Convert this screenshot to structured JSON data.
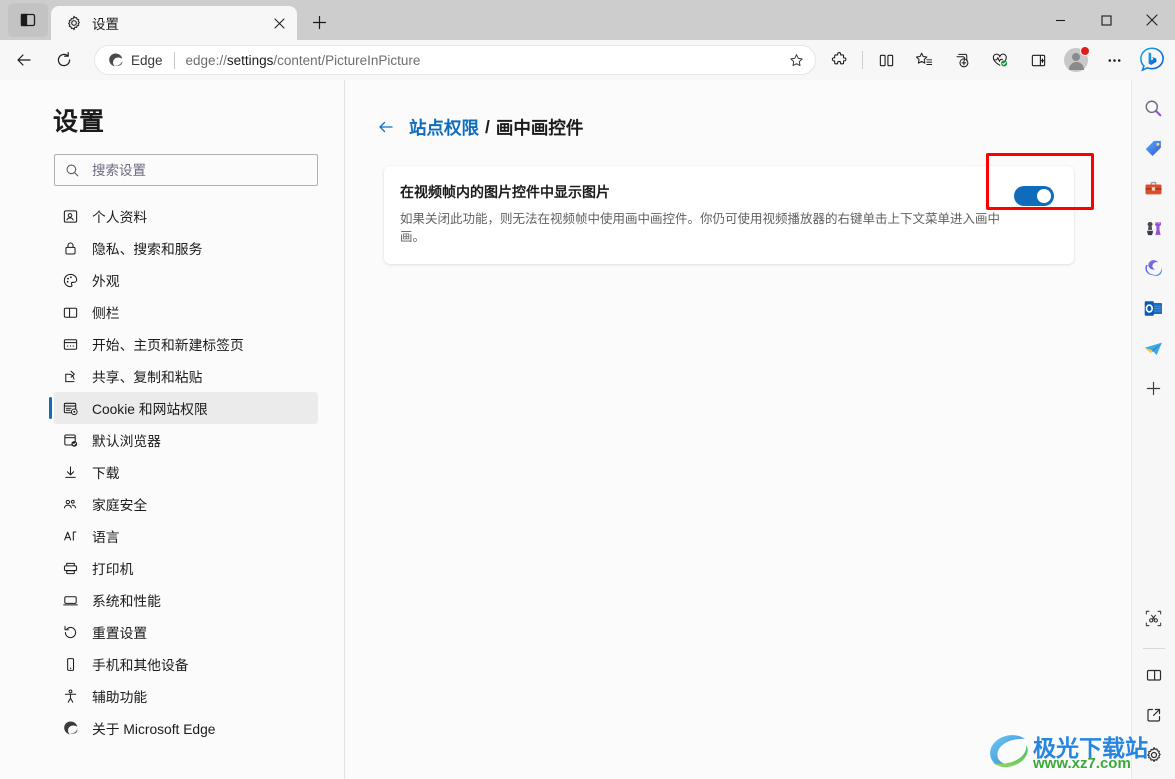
{
  "window": {
    "tab_actions_label": "tab-actions",
    "minimize_label": "–",
    "maximize_label": "□",
    "close_label": "✕"
  },
  "tab": {
    "title": "设置",
    "close_label": "✕",
    "new_tab_label": "+",
    "favicon": "gear-icon"
  },
  "toolbar": {
    "back_label": "←",
    "refresh_label": "⟳",
    "edge_badge_text": "Edge",
    "url_prefix": "edge://",
    "url_bold": "settings",
    "url_suffix": "/content/PictureInPicture",
    "url_full": "edge://settings/content/PictureInPicture",
    "icons": [
      {
        "name": "extensions-icon"
      },
      {
        "name": "split-screen-icon"
      },
      {
        "name": "favorites-icon"
      },
      {
        "name": "collections-icon"
      },
      {
        "name": "browser-essentials-icon"
      },
      {
        "name": "sidebar-toggle-icon"
      }
    ],
    "profile_name": "profile-avatar",
    "more_label": "⋯",
    "copilot_label": "b"
  },
  "sidebar": {
    "title": "设置",
    "search": {
      "placeholder": "搜索设置",
      "value": ""
    },
    "items": [
      {
        "label": "个人资料",
        "icon": "profile-icon",
        "selected": false
      },
      {
        "label": "隐私、搜索和服务",
        "icon": "lock-icon",
        "selected": false
      },
      {
        "label": "外观",
        "icon": "palette-icon",
        "selected": false
      },
      {
        "label": "侧栏",
        "icon": "sidebar-icon",
        "selected": false
      },
      {
        "label": "开始、主页和新建标签页",
        "icon": "home-page-icon",
        "selected": false
      },
      {
        "label": "共享、复制和粘贴",
        "icon": "share-icon",
        "selected": false
      },
      {
        "label": "Cookie 和网站权限",
        "icon": "cookie-permissions-icon",
        "selected": true
      },
      {
        "label": "默认浏览器",
        "icon": "default-browser-icon",
        "selected": false
      },
      {
        "label": "下载",
        "icon": "download-icon",
        "selected": false
      },
      {
        "label": "家庭安全",
        "icon": "family-safety-icon",
        "selected": false
      },
      {
        "label": "语言",
        "icon": "language-icon",
        "selected": false
      },
      {
        "label": "打印机",
        "icon": "printer-icon",
        "selected": false
      },
      {
        "label": "系统和性能",
        "icon": "system-icon",
        "selected": false
      },
      {
        "label": "重置设置",
        "icon": "reset-icon",
        "selected": false
      },
      {
        "label": "手机和其他设备",
        "icon": "phone-icon",
        "selected": false
      },
      {
        "label": "辅助功能",
        "icon": "accessibility-icon",
        "selected": false
      },
      {
        "label": "关于 Microsoft Edge",
        "icon": "edge-logo-icon",
        "selected": false
      }
    ]
  },
  "main": {
    "breadcrumb": {
      "back_label": "←",
      "parent": "站点权限",
      "separator": "/",
      "current": "画中画控件"
    },
    "setting": {
      "title": "在视频帧内的图片控件中显示图片",
      "description": "如果关闭此功能，则无法在视频帧中使用画中画控件。你仍可使用视频播放器的右键单击上下文菜单进入画中画。",
      "toggle_state": "on",
      "toggle_color": "#0f6cbd"
    },
    "annotation": {
      "color": "#fd0000"
    }
  },
  "edge_sidebar": {
    "items": [
      {
        "name": "search-icon"
      },
      {
        "name": "shopping-tag-icon"
      },
      {
        "name": "tools-briefcase-icon"
      },
      {
        "name": "games-chess-icon"
      },
      {
        "name": "microsoft365-icon"
      },
      {
        "name": "outlook-icon"
      },
      {
        "name": "telegram-icon"
      }
    ],
    "add_label": "+",
    "bottom_items": [
      {
        "name": "screenshot-icon"
      },
      {
        "name": "split-pane-icon"
      },
      {
        "name": "open-in-new-icon"
      },
      {
        "name": "settings-gear-icon"
      }
    ]
  },
  "watermark": {
    "text": "极光下载站",
    "url": "www.xz7.com"
  }
}
